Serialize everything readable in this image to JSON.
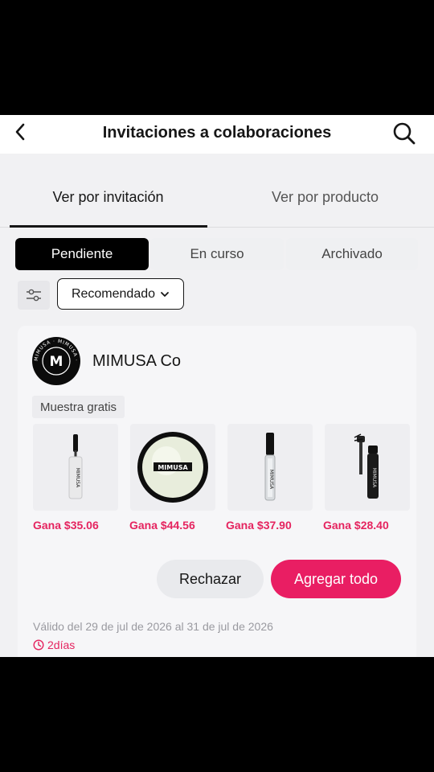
{
  "header": {
    "title": "Invitaciones a colaboraciones",
    "back_icon": "chevron-left-icon",
    "search_icon": "search-icon"
  },
  "tabs": [
    {
      "label": "Ver por invitación",
      "active": true
    },
    {
      "label": "Ver por producto",
      "active": false
    }
  ],
  "segments": [
    {
      "label": "Pendiente",
      "active": true
    },
    {
      "label": "En curso",
      "active": false
    },
    {
      "label": "Archivado",
      "active": false
    }
  ],
  "filters": {
    "filter_icon": "sliders-icon",
    "sort_label": "Recomendado"
  },
  "card": {
    "logo_text": "M",
    "logo_ring_text": "MIMUSA · MIMUSA ·",
    "brand": "MIMUSA Co",
    "badge": "Muestra gratis",
    "products": [
      {
        "label": "MIMUSA",
        "earn": "Gana $35.06",
        "kind": "mascara-clear"
      },
      {
        "label": "MIMUSA",
        "earn": "Gana $44.56",
        "kind": "compact"
      },
      {
        "label": "MIMUSA",
        "earn": "Gana $37.90",
        "kind": "tube-clear"
      },
      {
        "label": "MIMUSA",
        "earn": "Gana $28.40",
        "kind": "mascara-black"
      }
    ],
    "reject_label": "Rechazar",
    "add_all_label": "Agregar todo",
    "validity": "Válido del 29 de jul de 2026 al 31 de jul de 2026",
    "days_left": "2días",
    "accent_color": "#e91e63"
  }
}
